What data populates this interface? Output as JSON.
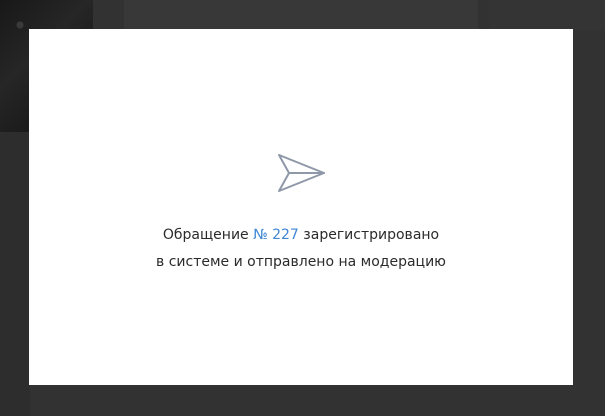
{
  "dialog": {
    "icon": "send-icon",
    "line1_prefix": "Обращение ",
    "ticket_number": "№ 227",
    "line1_suffix": " зарегистрировано",
    "line2": "в системе и отправлено на модерацию"
  },
  "colors": {
    "overlay": "#323232",
    "modal_background": "#ffffff",
    "text": "#2b2b2b",
    "accent": "#3f87d6",
    "icon_stroke": "#8f98a8"
  }
}
